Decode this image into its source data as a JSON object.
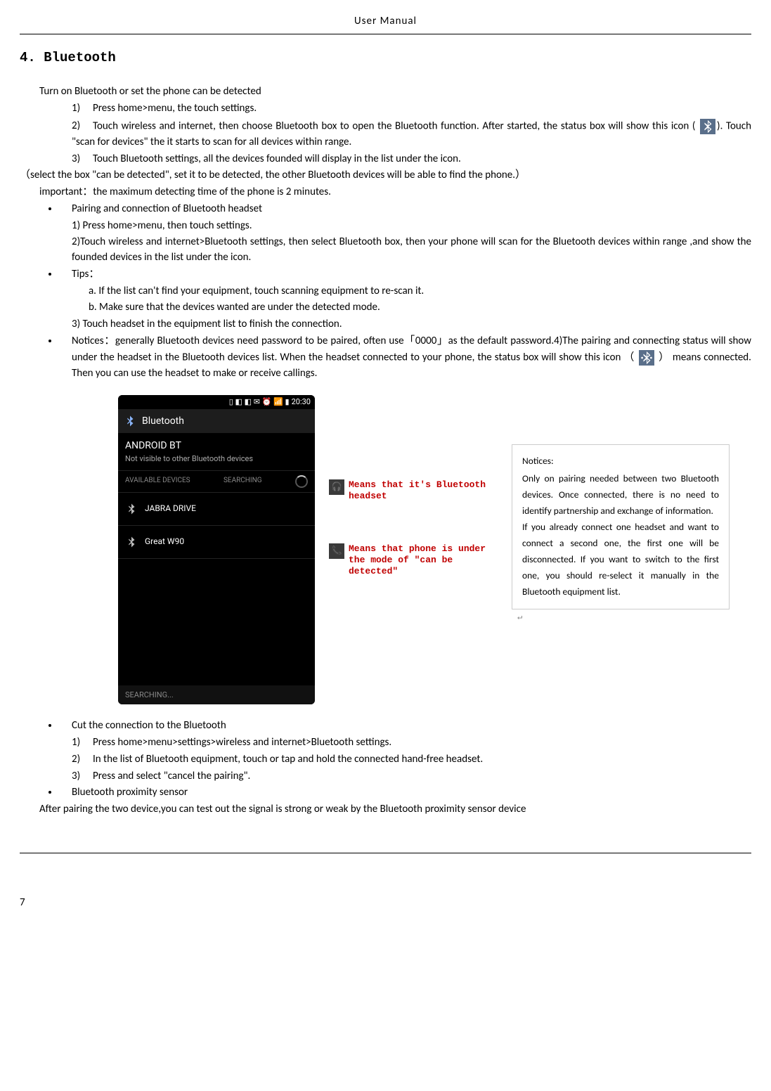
{
  "header": "User    Manual",
  "section_title": "4. Bluetooth",
  "intro": "Turn on Bluetooth or set the phone can be detected",
  "steps_main": [
    "Press home>menu, the touch settings.",
    "Touch wireless and internet, then choose Bluetooth box to open the Bluetooth function. After started, the status box will show this icon (",
    "). Touch   \"scan for devices\" the it starts to scan for all devices within range.",
    "Touch Bluetooth settings, all the devices founded will display in the list under the icon."
  ],
  "select_line": "（select the box \"can be detected\", set it to be detected, the other Bluetooth devices will be able to find the phone.）",
  "important_line": "important：the maximum detecting time of the phone is 2 minutes.",
  "pairing_title": "Pairing and connection of Bluetooth headset",
  "pairing_steps": [
    "1) Press home>menu, then touch settings.",
    "2)Touch wireless and internet>Bluetooth settings, then select Bluetooth box, then your phone will scan for the Bluetooth devices within range ,and show the founded devices in the list under the icon."
  ],
  "tips_title": "Tips：",
  "tips": [
    "a.  If the list can't find your equipment, touch scanning equipment to re-scan it.",
    "b.  Make sure that the devices wanted are under the detected mode."
  ],
  "tips_after": "3) Touch headset in the equipment list to finish the connection.",
  "notices_pre": "Notices：generally Bluetooth devices need password to be paired, often use「0000」as the default password.4)The pairing  and  connecting  status  will  show  under  the  headset  in  the  Bluetooth  devices  list.  When  the  headset connected  to  your  phone,  the  status  box  will  show  this  icon （",
  "notices_post": "） means  connected.  Then  you  can  use  the headset to make or receive callings.",
  "phone": {
    "time": "20:30",
    "title": "Bluetooth",
    "device_name": "ANDROID BT",
    "device_sub": "Not visible to other Bluetooth devices",
    "tab1": "AVAILABLE DEVICES",
    "tab2": "SEARCHING",
    "item1": "JABRA DRIVE",
    "item2": "Great W90",
    "footer": "SEARCHING..."
  },
  "annot1": "Means that it's Bluetooth headset",
  "annot2": "Means that phone is under the mode of \"can be detected\"",
  "notice_box": {
    "title": "Notices:",
    "body": "Only  on  pairing  needed  between  two Bluetooth devices. Once connected, there is no need to identify partnership and exchange of information.\nIf you already connect one headset and want to connect a second one, the first one will be disconnected. If you want to switch to the first one, you should re-select it manually in the Bluetooth equipment list."
  },
  "cut_title": "Cut the connection to the Bluetooth",
  "cut_steps": [
    "Press home>menu>settings>wireless and internet>Bluetooth settings.",
    "In the list of Bluetooth equipment, touch or tap and hold the connected hand-free headset.",
    "Press and select \"cancel the pairing\"."
  ],
  "prox_title": "Bluetooth proximity sensor",
  "prox_body": "After pairing the two device,you can test out the signal is strong or weak by the Bluetooth proximity sensor device",
  "pagenum": "7"
}
